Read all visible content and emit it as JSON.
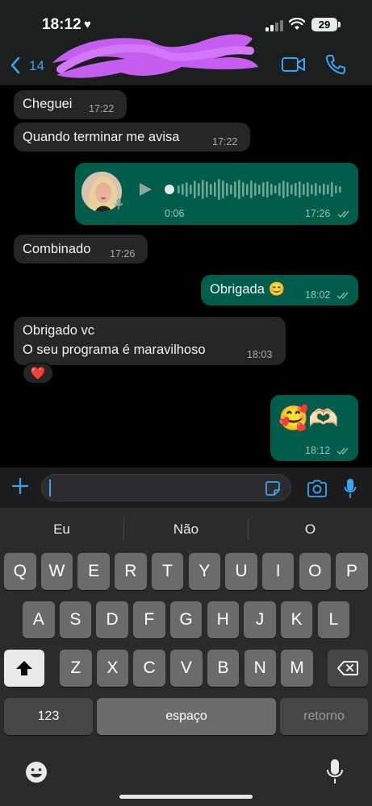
{
  "status_bar": {
    "time": "18:12",
    "battery": "29"
  },
  "header": {
    "back_count": "14"
  },
  "messages": [
    {
      "dir": "in",
      "text": "Cheguei",
      "time": "17:22"
    },
    {
      "dir": "in",
      "text": "Quando terminar me avisa",
      "time": "17:22"
    },
    {
      "dir": "out",
      "type": "voice",
      "duration": "0:06",
      "time": "17:26"
    },
    {
      "dir": "in",
      "text": "Combinado",
      "time": "17:26"
    },
    {
      "dir": "out",
      "text": "Obrigada 😊",
      "time": "18:02"
    },
    {
      "dir": "in",
      "line1": "Obrigado vc",
      "line2": "O seu programa é maravilhoso",
      "time": "18:03",
      "reaction": "❤️"
    },
    {
      "dir": "out",
      "text": "🥰🫶🏻",
      "time": "18:12"
    }
  ],
  "keyboard": {
    "suggestions": [
      "Eu",
      "Não",
      "O"
    ],
    "row1": [
      "Q",
      "W",
      "E",
      "R",
      "T",
      "Y",
      "U",
      "I",
      "O",
      "P"
    ],
    "row2": [
      "A",
      "S",
      "D",
      "F",
      "G",
      "H",
      "J",
      "K",
      "L"
    ],
    "row3": [
      "Z",
      "X",
      "C",
      "V",
      "B",
      "N",
      "M"
    ],
    "numbers_label": "123",
    "space_label": "espaço",
    "return_label": "retorno"
  },
  "colors": {
    "incoming": "#262626",
    "outgoing": "#005c4b",
    "accent": "#3ba4f5"
  }
}
